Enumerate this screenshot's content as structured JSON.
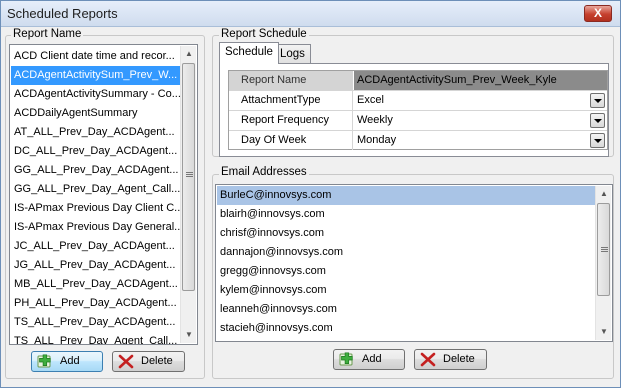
{
  "window": {
    "title": "Scheduled Reports",
    "close_label": "X"
  },
  "report_name_group": {
    "label": "Report Name"
  },
  "reports": [
    {
      "label": "ACD Client date time and recor..."
    },
    {
      "label": "ACDAgentActivitySum_Prev_W..."
    },
    {
      "label": "ACDAgentActivitySummary - Co..."
    },
    {
      "label": "ACDDailyAgentSummary"
    },
    {
      "label": "AT_ALL_Prev_Day_ACDAgent..."
    },
    {
      "label": "DC_ALL_Prev_Day_ACDAgent..."
    },
    {
      "label": "GG_ALL_Prev_Day_ACDAgent..."
    },
    {
      "label": "GG_ALL_Prev_Day_Agent_Call..."
    },
    {
      "label": "IS-APmax Previous Day Client C..."
    },
    {
      "label": "IS-APmax Previous Day General..."
    },
    {
      "label": "JC_ALL_Prev_Day_ACDAgent..."
    },
    {
      "label": "JG_ALL_Prev_Day_ACDAgent..."
    },
    {
      "label": "MB_ALL_Prev_Day_ACDAgent..."
    },
    {
      "label": "PH_ALL_Prev_Day_ACDAgent..."
    },
    {
      "label": "TS_ALL_Prev_Day_ACDAgent..."
    },
    {
      "label": "TS_ALL_Prev_Day_Agent_Call..."
    }
  ],
  "reports_selected_index": 1,
  "report_buttons": {
    "add": "Add",
    "delete": "Delete"
  },
  "schedule_group": {
    "label": "Report Schedule"
  },
  "tabs": [
    {
      "label": "Schedule"
    },
    {
      "label": "Logs"
    }
  ],
  "active_tab": 0,
  "schedule_grid": {
    "rows": [
      {
        "label": "Report Name",
        "value": "ACDAgentActivitySum_Prev_Week_Kyle"
      },
      {
        "label": "AttachmentType",
        "value": "Excel"
      },
      {
        "label": "Report Frequency",
        "value": "Weekly"
      },
      {
        "label": "Day Of Week",
        "value": "Monday"
      }
    ]
  },
  "email_group": {
    "label": "Email Addresses"
  },
  "emails": [
    "BurleC@innovsys.com",
    "blairh@innovsys.com",
    "chrisf@innovsys.com",
    "dannajon@innovsys.com",
    "gregg@innovsys.com",
    "kylem@innovsys.com",
    "leanneh@innovsys.com",
    "stacieh@innovsys.com"
  ],
  "emails_selected_index": 0,
  "email_buttons": {
    "add": "Add",
    "delete": "Delete"
  },
  "icons": {
    "add": "add-green-plus-icon",
    "delete": "delete-red-x-icon"
  },
  "colors": {
    "selection": "#3399ff",
    "email_selection": "#a9c4e6",
    "close_button": "#c6402e"
  }
}
